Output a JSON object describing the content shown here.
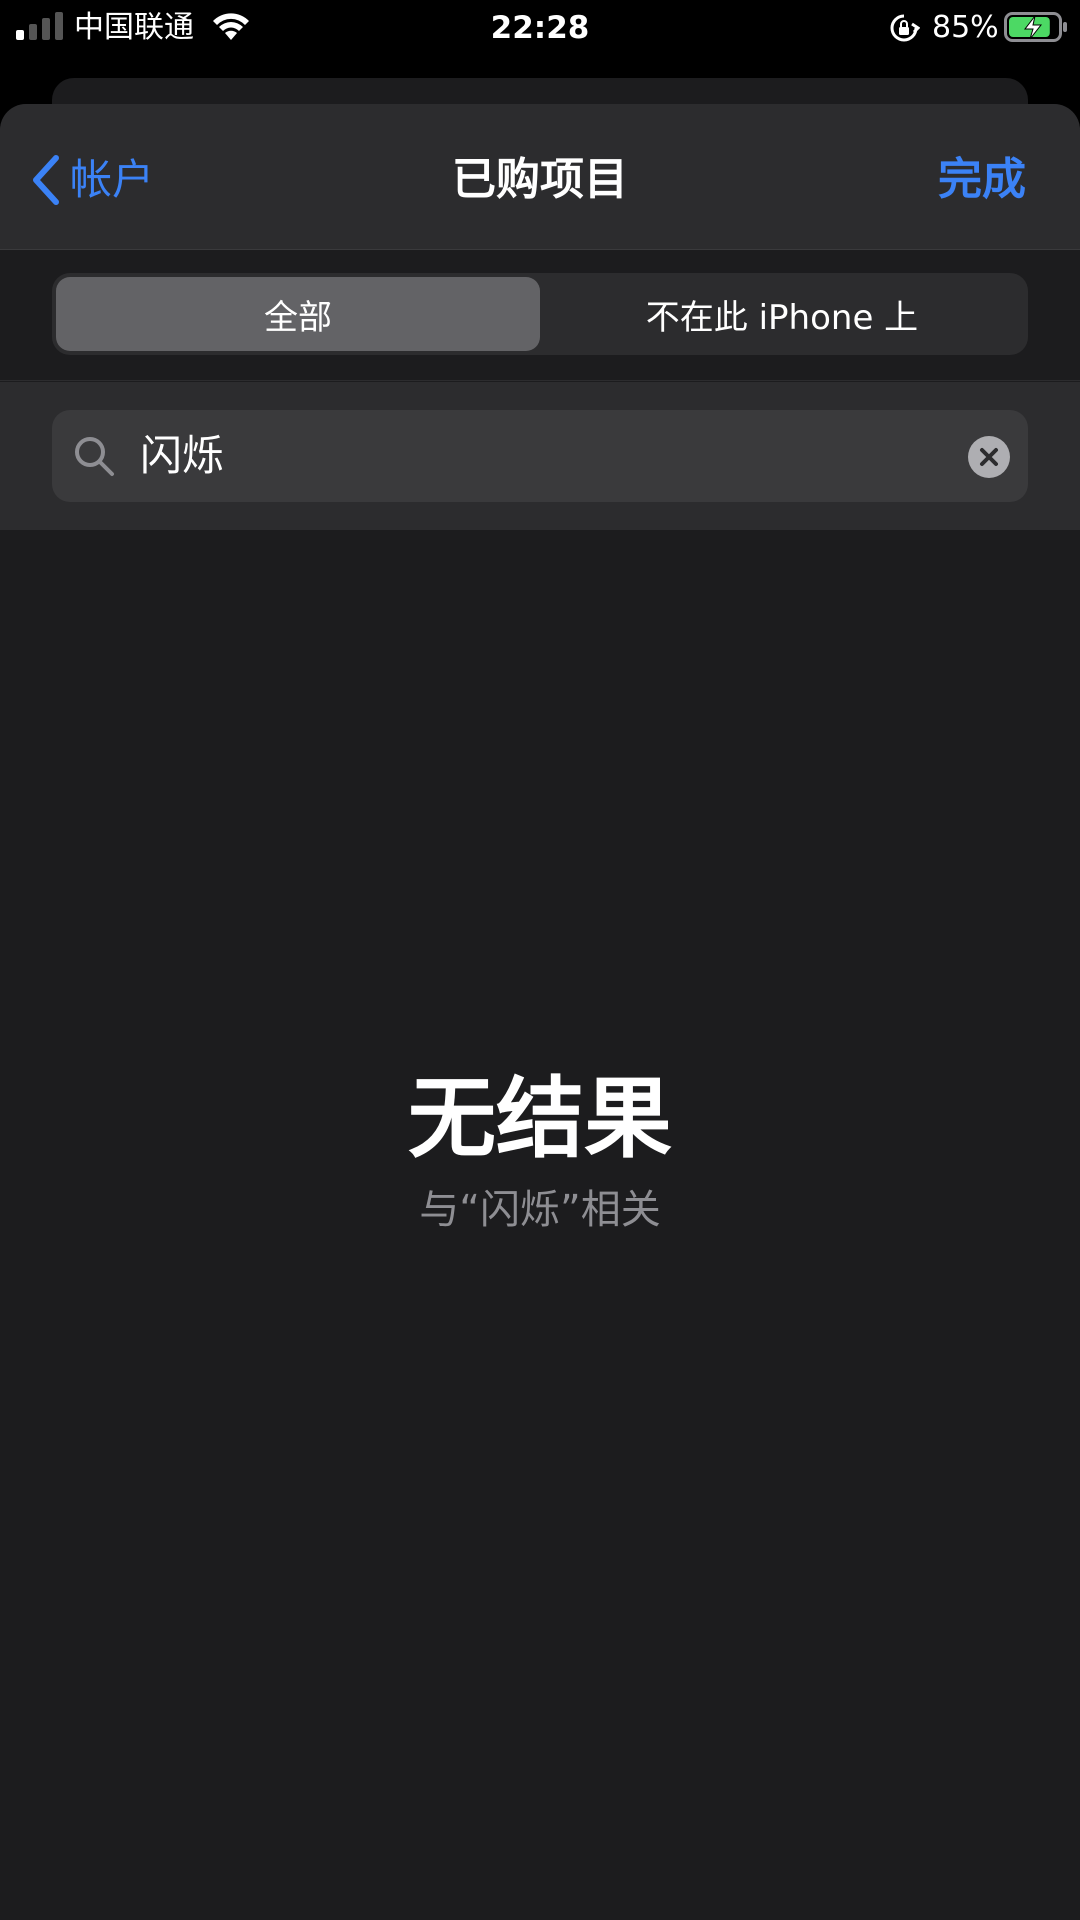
{
  "status_bar": {
    "carrier": "中国联通",
    "time": "22:28",
    "battery_percent": "85%",
    "battery_level": 0.85,
    "signal_bars_active": 1,
    "icons": [
      "signal-icon",
      "wifi-icon",
      "orientation-lock-icon",
      "battery-charging-icon"
    ]
  },
  "nav": {
    "back_label": "帐户",
    "title": "已购项目",
    "done_label": "完成"
  },
  "segments": [
    {
      "label": "全部",
      "selected": true
    },
    {
      "label": "不在此 iPhone 上",
      "selected": false
    }
  ],
  "search": {
    "value": "闪烁"
  },
  "empty_state": {
    "title": "无结果",
    "subtitle": "与“闪烁”相关"
  },
  "colors": {
    "accent": "#3b82f6",
    "background": "#1c1c1e",
    "battery_fill": "#4cd964"
  }
}
